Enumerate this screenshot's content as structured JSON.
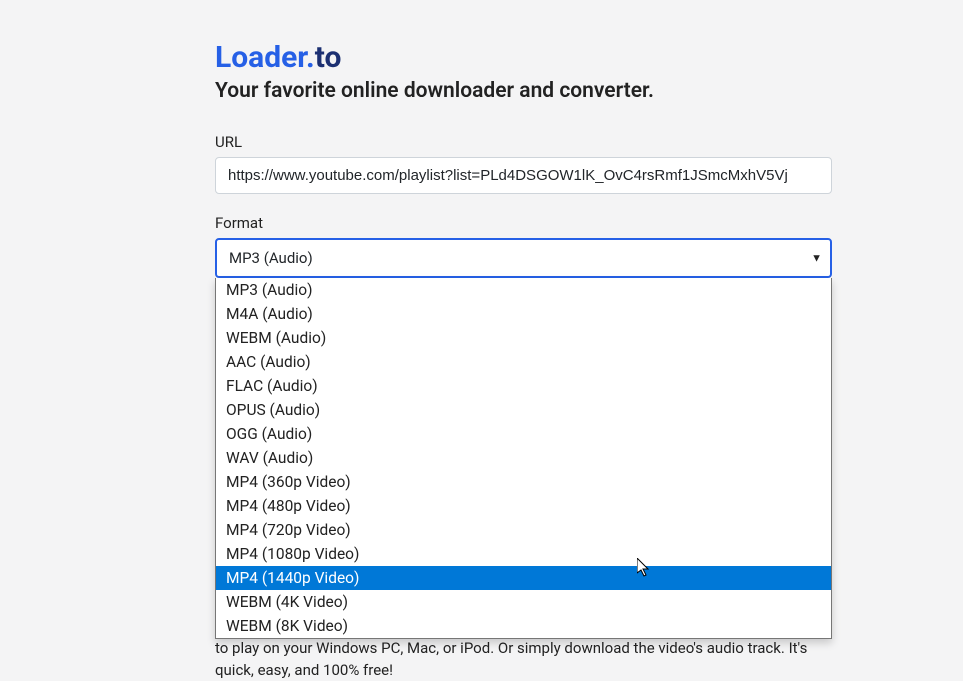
{
  "logo": {
    "primary": "Loader.",
    "secondary": "to"
  },
  "subtitle": "Your favorite online downloader and converter.",
  "url": {
    "label": "URL",
    "value": "https://www.youtube.com/playlist?list=PLd4DSGOW1lK_OvC4rsRmf1JSmcMxhV5Vj"
  },
  "format": {
    "label": "Format",
    "selected": "MP3 (Audio)",
    "options": [
      "MP3 (Audio)",
      "M4A (Audio)",
      "WEBM (Audio)",
      "AAC (Audio)",
      "FLAC (Audio)",
      "OPUS (Audio)",
      "OGG (Audio)",
      "WAV (Audio)",
      "MP4 (360p Video)",
      "MP4 (480p Video)",
      "MP4 (720p Video)",
      "MP4 (1080p Video)",
      "MP4 (1440p Video)",
      "WEBM (4K Video)",
      "WEBM (8K Video)"
    ],
    "highlightedIndex": 12
  },
  "bottomText": "enter the YouTube video link below and our system will do the rest. Instantly convert files to play on your Windows PC, Mac, or iPod. Or simply download the video's audio track. It's quick, easy, and 100% free!"
}
